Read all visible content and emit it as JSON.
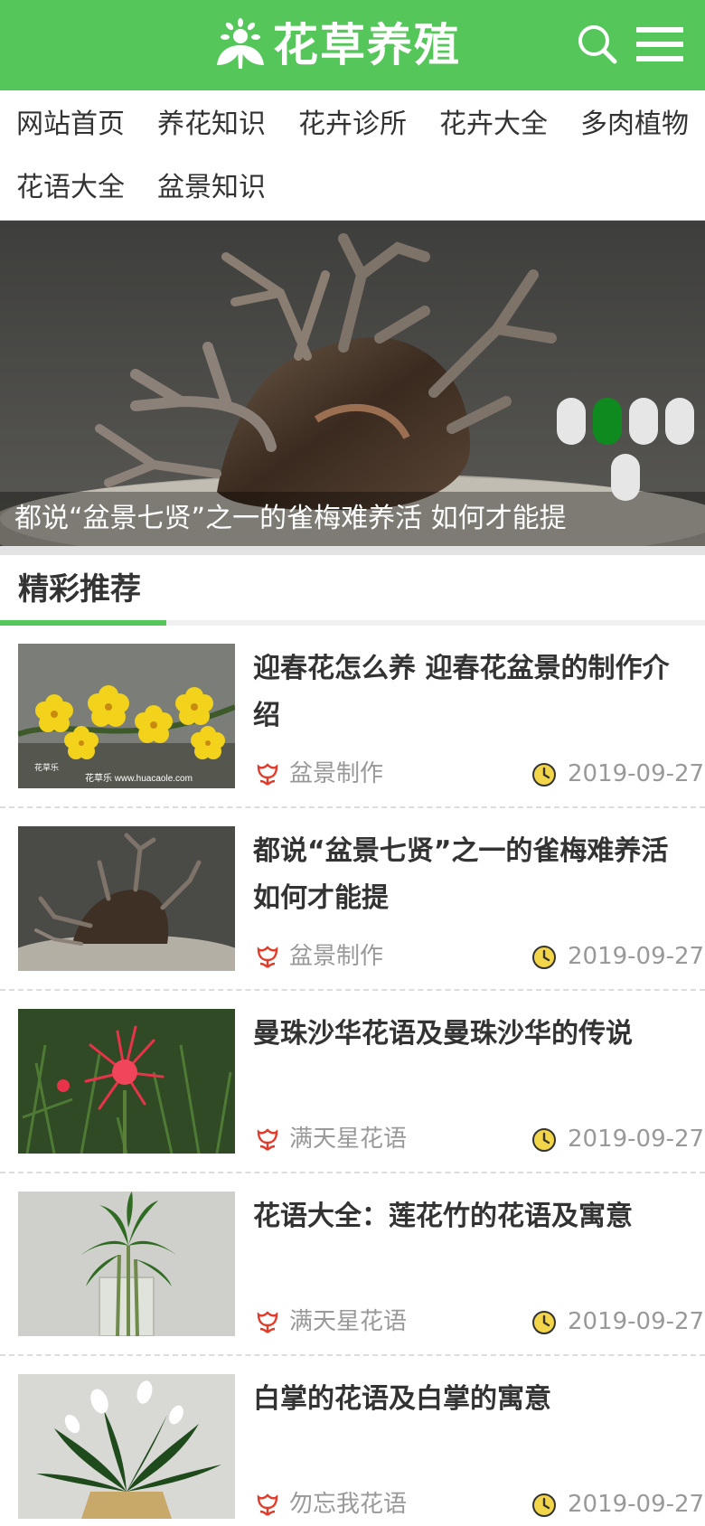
{
  "header": {
    "title": "花草养殖",
    "logo_icon": "flower-logo-icon",
    "search_icon": "search-icon",
    "menu_icon": "menu-icon",
    "brand_color": "#54c65a"
  },
  "nav": {
    "items": [
      {
        "label": "网站首页"
      },
      {
        "label": "养花知识"
      },
      {
        "label": "花卉诊所"
      },
      {
        "label": "花卉大全"
      },
      {
        "label": "多肉植物"
      },
      {
        "label": "花语大全"
      },
      {
        "label": "盆景知识"
      }
    ]
  },
  "banner": {
    "caption": "都说“盆景七贤”之一的雀梅难养活 如何才能提",
    "slide_count": 5,
    "active_slide": 2
  },
  "recommend": {
    "title": "精彩推荐",
    "items": [
      {
        "title": "迎春花怎么养 迎春花盆景的制作介绍",
        "category": "盆景制作",
        "date": "2019-09-27",
        "image": "yellow-jasmine-flowers",
        "watermark_left": "花草乐",
        "watermark_right": "花草乐  www.huacaole.com"
      },
      {
        "title": "都说“盆景七贤”之一的雀梅难养活 如何才能提",
        "category": "盆景制作",
        "date": "2019-09-27",
        "image": "bonsai-stump"
      },
      {
        "title": "曼珠沙华花语及曼珠沙华的传说",
        "category": "满天星花语",
        "date": "2019-09-27",
        "image": "red-spider-lily"
      },
      {
        "title": "花语大全：莲花竹的花语及寓意",
        "category": "满天星花语",
        "date": "2019-09-27",
        "image": "lucky-bamboo-vase"
      },
      {
        "title": "白掌的花语及白掌的寓意",
        "category": "勿忘我花语",
        "date": "2019-09-27",
        "image": "peace-lily"
      }
    ]
  }
}
